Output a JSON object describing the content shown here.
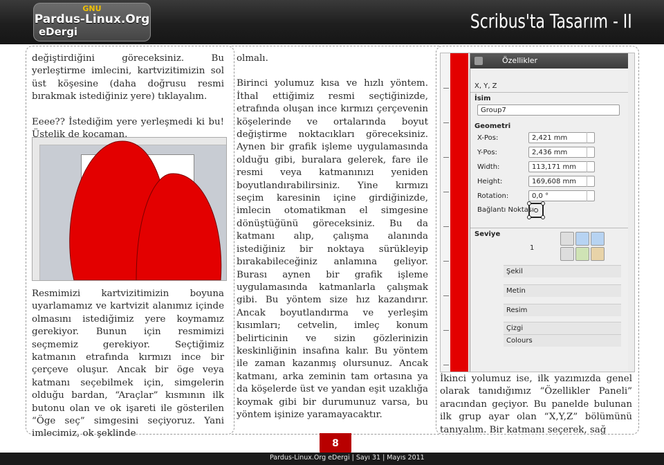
{
  "header": {
    "logo_top": "GNU",
    "logo_name": "Pardus-Linux.Org",
    "logo_sub": "eDergi",
    "title": "Scribus'ta Tasarım - II"
  },
  "column1": {
    "para1": "değiştirdiğini göreceksiniz. Bu yerleştirme imlecini, kartvizitimizin sol üst köşesine (daha doğrusu resmi bırakmak istediğiniz yere) tıklayalım.",
    "para2": "Eeee?? İstediğim yere yerleşmedi ki bu! Üstelik de kocaman.",
    "para3": "Resmimizi kartvizitimizin boyuna uyarlamamız ve kartvizit alanımız içinde olmasını istediğimiz yere koymamız gerekiyor. Bunun için resmimizi seçmemiz gerekiyor. Seçtiğimiz katmanın etrafında kırmızı ince bir çerçeve oluşur. Ancak bir öge veya katmanı seçebilmek için, simgelerin olduğu bardan, “Araçlar” kısmının ilk butonu olan ve ok işareti ile gösterilen “Öge seç” simgesini seçiyoruz. Yani imlecimiz, ok şeklinde"
  },
  "column2": {
    "para1": "olmalı.",
    "para2": "Birinci yolumuz kısa ve hızlı yöntem. İthal ettiğimiz resmi seçtiğinizde, etrafında oluşan ince kırmızı çerçevenin köşelerinde ve ortalarında boyut değiştirme noktacıkları göreceksiniz. Aynen bir grafik işleme uygulamasında olduğu gibi, buralara gelerek, fare ile resmi veya katmanınızı yeniden boyutlandırabilirsiniz. Yine kırmızı seçim karesinin içine girdiğinizde, imlecin otomatikman el simgesine dönüştüğünü göreceksiniz. Bu da katmanı alıp, çalışma alanında istediğiniz bir noktaya sürükleyip bırakabileceğiniz anlamına geliyor. Burası aynen bir grafik işleme uygulamasında katmanlarla çalışmak gibi. Bu yöntem size hız kazandırır. Ancak boyutlandırma ve yerleşim kısımları; cetvelin, imleç konum belirticinin ve sizin gözlerinizin keskinliğinin insafına kalır. Bu yöntem ile zaman kazanmış olursunuz. Ancak katmanı, arka zeminin tam ortasına ya da köşelerde üst ve yandan eşit uzaklığa koymak gibi bir durumunuz varsa, bu yöntem işinize yaramayacaktır."
  },
  "column3": {
    "para1": "İkinci yolumuz ise, ilk yazımızda genel olarak tanıdığımız “Özellikler Paneli” aracından geçiyor. Bu panelde bulunan ilk grup ayar olan “X,Y,Z” bölümünü tanıyalım. Bir katmanı seçerek, sağ"
  },
  "panel": {
    "title": "Özellikler",
    "tab_xyz": "X, Y, Z",
    "name_label": "İsim",
    "name_value": "Group7",
    "geometry_label": "Geometri",
    "xpos_label": "X-Pos:",
    "xpos_value": "2,421 mm",
    "ypos_label": "Y-Pos:",
    "ypos_value": "2,436 mm",
    "width_label": "Width:",
    "width_value": "113,171 mm",
    "height_label": "Height:",
    "height_value": "169,608 mm",
    "rotation_label": "Rotation:",
    "rotation_value": "0,0 °",
    "anchor_label": "Bağlantı Noktası:",
    "level_label": "Seviye",
    "level_value": "1",
    "section_shape": "Şekil",
    "section_text": "Metin",
    "section_image": "Resim",
    "section_line": "Çizgi",
    "section_colours": "Colours"
  },
  "footer": {
    "page_number": "8",
    "text": "Pardus-Linux.Org eDergi | Sayı 31 | Mayıs 2011"
  },
  "colors": {
    "accent_red": "#e30000",
    "page_badge": "#b80000",
    "header_bg": "#1e1e1e"
  }
}
